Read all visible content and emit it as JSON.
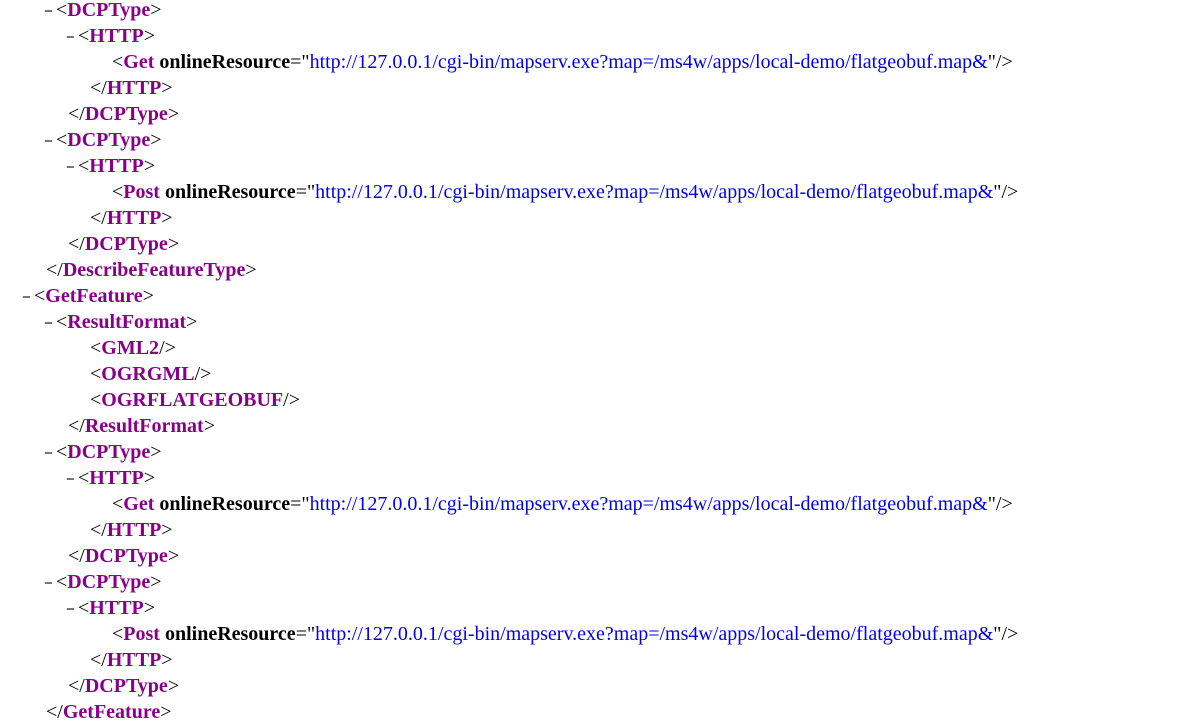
{
  "viewer": {
    "toggle_symbol": "−",
    "lines": [
      {
        "indent": 56,
        "toggle": true,
        "kind": "open",
        "tag": "DCPType"
      },
      {
        "indent": 78,
        "toggle": true,
        "kind": "open",
        "tag": "HTTP"
      },
      {
        "indent": 112,
        "toggle": false,
        "kind": "selfclose-attr",
        "tag": "Get",
        "attr": "onlineResource",
        "value": "http://127.0.0.1/cgi-bin/mapserv.exe?map=/ms4w/apps/local-demo/flatgeobuf.map&"
      },
      {
        "indent": 90,
        "toggle": false,
        "kind": "close",
        "tag": "HTTP"
      },
      {
        "indent": 68,
        "toggle": false,
        "kind": "close",
        "tag": "DCPType"
      },
      {
        "indent": 56,
        "toggle": true,
        "kind": "open",
        "tag": "DCPType"
      },
      {
        "indent": 78,
        "toggle": true,
        "kind": "open",
        "tag": "HTTP"
      },
      {
        "indent": 112,
        "toggle": false,
        "kind": "selfclose-attr",
        "tag": "Post",
        "attr": "onlineResource",
        "value": "http://127.0.0.1/cgi-bin/mapserv.exe?map=/ms4w/apps/local-demo/flatgeobuf.map&"
      },
      {
        "indent": 90,
        "toggle": false,
        "kind": "close",
        "tag": "HTTP"
      },
      {
        "indent": 68,
        "toggle": false,
        "kind": "close",
        "tag": "DCPType"
      },
      {
        "indent": 46,
        "toggle": false,
        "kind": "close",
        "tag": "DescribeFeatureType"
      },
      {
        "indent": 34,
        "toggle": true,
        "kind": "open",
        "tag": "GetFeature"
      },
      {
        "indent": 56,
        "toggle": true,
        "kind": "open",
        "tag": "ResultFormat"
      },
      {
        "indent": 90,
        "toggle": false,
        "kind": "selfclose",
        "tag": "GML2"
      },
      {
        "indent": 90,
        "toggle": false,
        "kind": "selfclose",
        "tag": "OGRGML"
      },
      {
        "indent": 90,
        "toggle": false,
        "kind": "selfclose",
        "tag": "OGRFLATGEOBUF"
      },
      {
        "indent": 68,
        "toggle": false,
        "kind": "close",
        "tag": "ResultFormat"
      },
      {
        "indent": 56,
        "toggle": true,
        "kind": "open",
        "tag": "DCPType"
      },
      {
        "indent": 78,
        "toggle": true,
        "kind": "open",
        "tag": "HTTP"
      },
      {
        "indent": 112,
        "toggle": false,
        "kind": "selfclose-attr",
        "tag": "Get",
        "attr": "onlineResource",
        "value": "http://127.0.0.1/cgi-bin/mapserv.exe?map=/ms4w/apps/local-demo/flatgeobuf.map&"
      },
      {
        "indent": 90,
        "toggle": false,
        "kind": "close",
        "tag": "HTTP"
      },
      {
        "indent": 68,
        "toggle": false,
        "kind": "close",
        "tag": "DCPType"
      },
      {
        "indent": 56,
        "toggle": true,
        "kind": "open",
        "tag": "DCPType"
      },
      {
        "indent": 78,
        "toggle": true,
        "kind": "open",
        "tag": "HTTP"
      },
      {
        "indent": 112,
        "toggle": false,
        "kind": "selfclose-attr",
        "tag": "Post",
        "attr": "onlineResource",
        "value": "http://127.0.0.1/cgi-bin/mapserv.exe?map=/ms4w/apps/local-demo/flatgeobuf.map&"
      },
      {
        "indent": 90,
        "toggle": false,
        "kind": "close",
        "tag": "HTTP"
      },
      {
        "indent": 68,
        "toggle": false,
        "kind": "close",
        "tag": "DCPType"
      },
      {
        "indent": 46,
        "toggle": false,
        "kind": "close",
        "tag": "GetFeature"
      }
    ]
  }
}
